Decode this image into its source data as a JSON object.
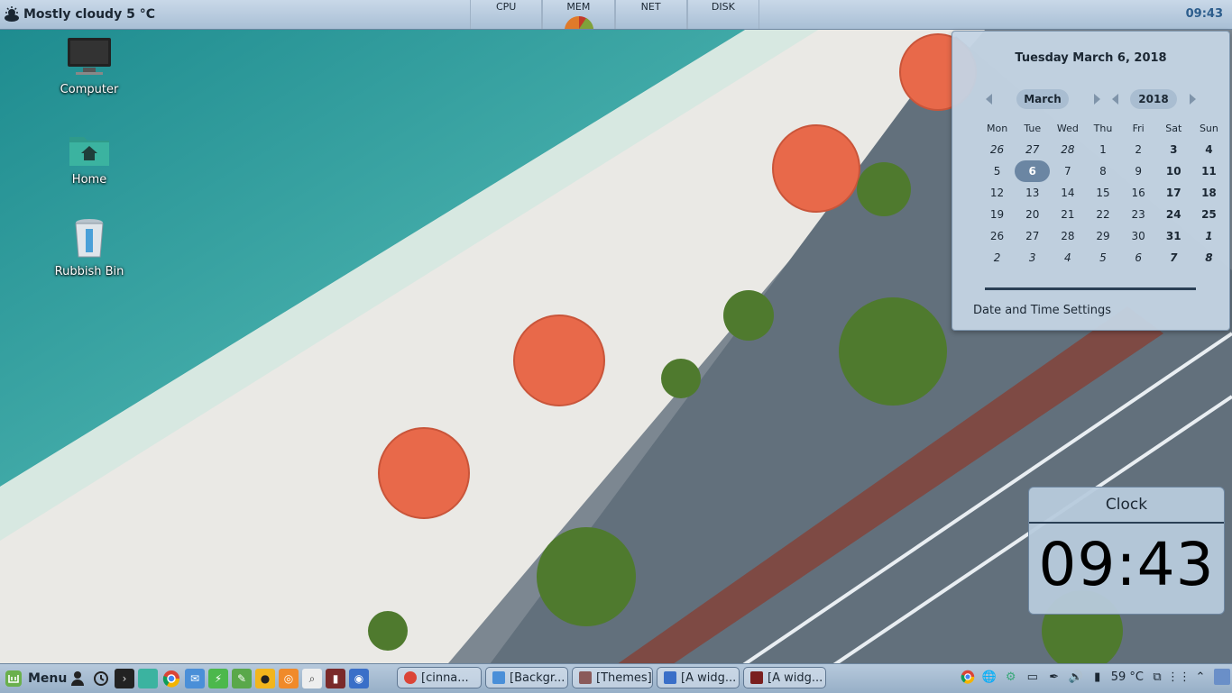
{
  "top_panel": {
    "weather": "Mostly cloudy 5 °C",
    "clock": "09:43",
    "monitors": [
      "CPU",
      "MEM",
      "NET",
      "DISK"
    ]
  },
  "desktop": {
    "icons": [
      {
        "label": "Computer",
        "icon": "monitor-icon"
      },
      {
        "label": "Home",
        "icon": "home-folder-icon"
      },
      {
        "label": "Rubbish Bin",
        "icon": "trash-icon"
      }
    ]
  },
  "calendar": {
    "date_title": "Tuesday March 6, 2018",
    "month": "March",
    "year": "2018",
    "weekdays": [
      "Mon",
      "Tue",
      "Wed",
      "Thu",
      "Fri",
      "Sat",
      "Sun"
    ],
    "weeks": [
      [
        "26",
        "27",
        "28",
        "1",
        "2",
        "3",
        "4"
      ],
      [
        "5",
        "6",
        "7",
        "8",
        "9",
        "10",
        "11"
      ],
      [
        "12",
        "13",
        "14",
        "15",
        "16",
        "17",
        "18"
      ],
      [
        "19",
        "20",
        "21",
        "22",
        "23",
        "24",
        "25"
      ],
      [
        "26",
        "27",
        "28",
        "29",
        "30",
        "31",
        "1"
      ],
      [
        "2",
        "3",
        "4",
        "5",
        "6",
        "7",
        "8"
      ]
    ],
    "today": "6",
    "settings_label": "Date and Time Settings"
  },
  "clock_desklet": {
    "title": "Clock",
    "time": "09:43"
  },
  "bottom_panel": {
    "menu_label": "Menu",
    "launchers": [
      "user-icon",
      "history-icon",
      "terminal-icon",
      "files-icon",
      "chrome-icon",
      "mail-icon",
      "green-app-icon",
      "tools-icon",
      "yellow-app-icon",
      "firefox-icon",
      "search-icon",
      "red-app-icon",
      "camera-icon"
    ],
    "tasks": [
      "[cinna...",
      "[Backgr...",
      "[Themes]",
      "[A widg...",
      "[A widg..."
    ],
    "temperature": "59 °C"
  },
  "colors": {
    "panel": "#a9bfd5",
    "accent": "#2c5d8c",
    "umbrella": "#e8694a"
  }
}
